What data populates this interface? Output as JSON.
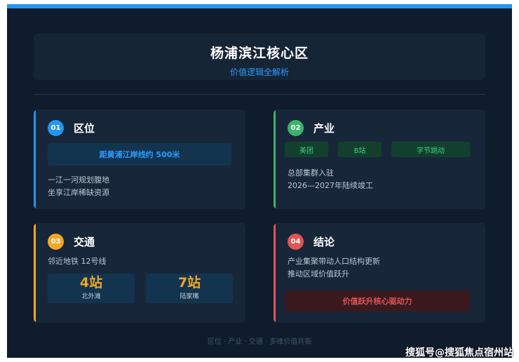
{
  "header": {
    "title": "杨浦滨江核心区",
    "subtitle": "价值逻辑全解析"
  },
  "colors": {
    "accent_blue": "#2196f3",
    "accent_green": "#3ab36c",
    "accent_orange": "#f5a623",
    "accent_red": "#e05555",
    "background": "#101c2b"
  },
  "cards": {
    "location": {
      "number": "01",
      "title": "区位",
      "highlight": "距黄浦江岸线约 500米",
      "lines": [
        "一江一河规划腹地",
        "坐享江岸稀缺资源"
      ]
    },
    "industry": {
      "number": "02",
      "title": "产业",
      "tags": [
        "美团",
        "B站",
        "字节跳动"
      ],
      "lines": [
        "总部集群入驻",
        "2026—2027年陆续竣工"
      ]
    },
    "transport": {
      "number": "03",
      "title": "交通",
      "subtitle": "邻近地铁 12号线",
      "stats": [
        {
          "value": "4站",
          "label": "北外滩"
        },
        {
          "value": "7站",
          "label": "陆家嘴"
        }
      ]
    },
    "conclusion": {
      "number": "04",
      "title": "结论",
      "lines": [
        "产业集聚带动人口结构更新",
        "推动区域价值跃升"
      ],
      "highlight": "价值跃升核心驱动力"
    }
  },
  "footer": {
    "text": "区位 · 产业 · 交通 · 多维价值共振"
  },
  "watermark": {
    "text": "搜狐号@搜狐焦点宿州站"
  }
}
